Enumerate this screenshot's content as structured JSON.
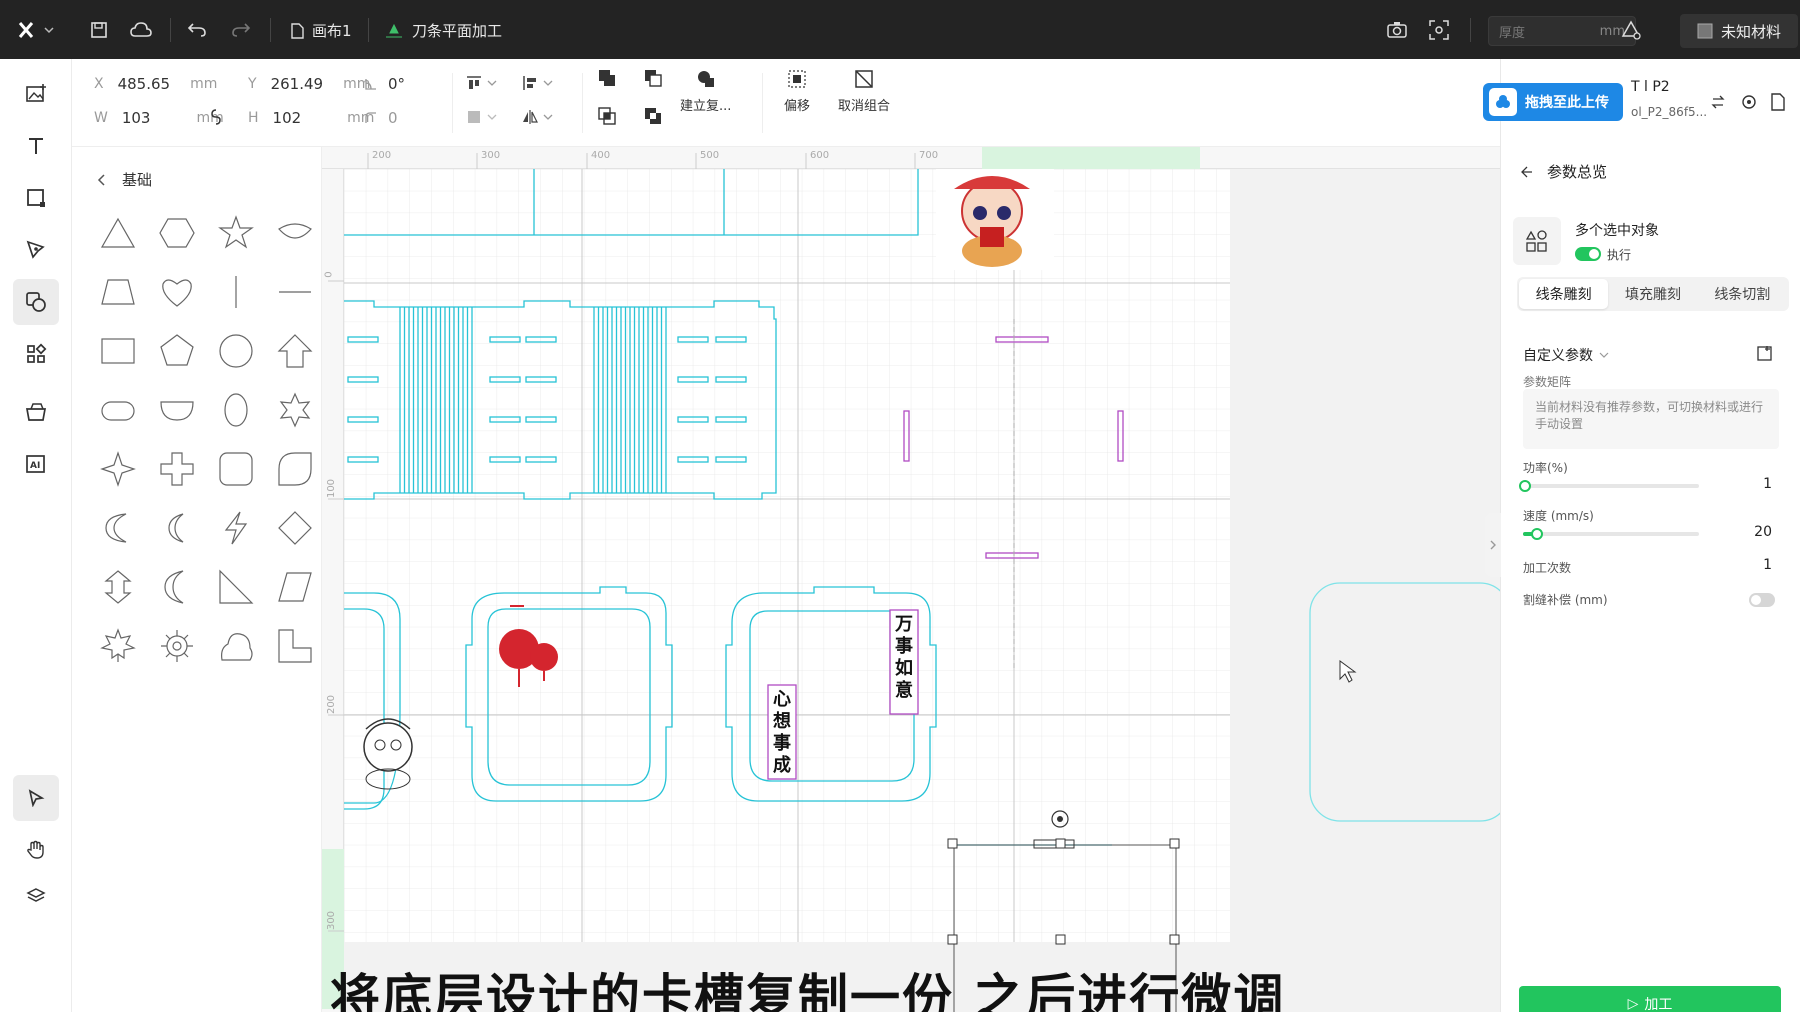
{
  "topbar": {
    "canvas_tab": "画布1",
    "process_mode": "刀条平面加工",
    "thickness_placeholder": "厚度",
    "thickness_unit": "mm",
    "material": "未知材料"
  },
  "props": {
    "x_label": "X",
    "x_value": "485.65",
    "x_unit": "mm",
    "y_label": "Y",
    "y_value": "261.49",
    "y_unit": "mm",
    "rotation": "0°",
    "w_label": "W",
    "w_value": "103",
    "w_unit": "mm",
    "h_label": "H",
    "h_value": "102",
    "h_unit": "mm",
    "corner": "0",
    "create_compound": "建立复...",
    "offset": "偏移",
    "ungroup": "取消组合"
  },
  "shapes_panel": {
    "title": "基础",
    "shapes": [
      "triangle",
      "hexagon",
      "star",
      "rhombus-curve",
      "trapezoid",
      "heart",
      "vertical-line",
      "horizontal-line",
      "rectangle",
      "pentagon",
      "circle",
      "arrow-up",
      "capsule",
      "semicircle",
      "ellipse",
      "star-6",
      "star-4",
      "cross",
      "rounded-square",
      "leaf",
      "crescent-c",
      "crescent-thin",
      "lightning",
      "diamond",
      "double-arrow",
      "moon",
      "right-triangle",
      "parallelogram",
      "maple-leaf",
      "gear",
      "cloud",
      "l-shape"
    ]
  },
  "rulers": {
    "top": [
      "200",
      "300",
      "400",
      "500",
      "600",
      "700"
    ],
    "left": [
      "0",
      "100",
      "200",
      "300"
    ]
  },
  "canvas": {
    "text_right_top": "万事如意",
    "text_left_bottom": "心想事成"
  },
  "right_panel": {
    "upload_label": "拖拽至此上传",
    "device_name": "T    l P2",
    "device_sub": "ol_P2_86f5...",
    "section_title": "参数总览",
    "multi_object": "多个选中对象",
    "execute": "执行",
    "tabs": [
      "线条雕刻",
      "填充雕刻",
      "线条切割"
    ],
    "custom_params": "自定义参数",
    "matrix_label": "参数矩阵",
    "matrix_hint": "当前材料没有推荐参数，可切换材料或进行手动设置",
    "power_label": "功率(%)",
    "power_value": "1",
    "speed_label": "速度 (mm/s)",
    "speed_value": "20",
    "passes_label": "加工次数",
    "passes_value": "1",
    "kerf_label": "割缝补偿 (mm)",
    "process_button": "加工",
    "more": "···"
  },
  "subtitle": "将底层设计的卡槽复制一份 之后进行微调",
  "colors": {
    "cut_line": "#27c3d6",
    "engrave_line": "#b04cc4",
    "accent_green": "#22c55e",
    "upload_blue": "#1e88e5"
  }
}
